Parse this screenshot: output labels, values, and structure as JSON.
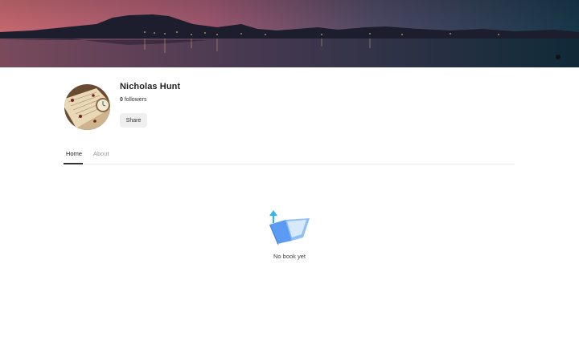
{
  "banner": {
    "icon": "lake-night-landscape"
  },
  "profile": {
    "avatar_icon": "book-with-pocket-watch",
    "name": "Nicholas Hunt",
    "followers_count": "0",
    "followers_label": "followers",
    "share_label": "Share"
  },
  "tabs": [
    {
      "label": "Home",
      "active": true
    },
    {
      "label": "About",
      "active": false
    }
  ],
  "empty_state": {
    "icon": "book-upload-icon",
    "message": "No book yet"
  },
  "colors": {
    "accent_blue": "#4a90f0",
    "arrow_cyan": "#2cb7f0"
  }
}
